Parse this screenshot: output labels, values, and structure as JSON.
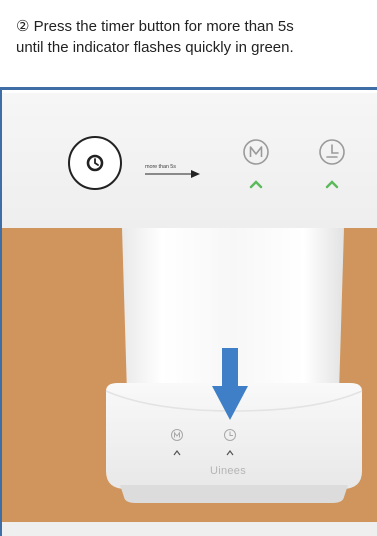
{
  "instruction": {
    "line1": "② Press the timer button for more than 5s",
    "line2": "until the indicator flashes quickly in green."
  },
  "callout": {
    "arrow_label": "more than 5s"
  },
  "device": {
    "brand": "Uinees"
  },
  "colors": {
    "frame": "#3f6ea6",
    "indicator_green": "#5cb95c",
    "arrow_blue": "#3f7fc7",
    "wood": "#cf955c"
  },
  "icons": [
    "timer-icon",
    "mode-icon",
    "clock-icon",
    "chevron-up-icon",
    "down-arrow-icon"
  ]
}
